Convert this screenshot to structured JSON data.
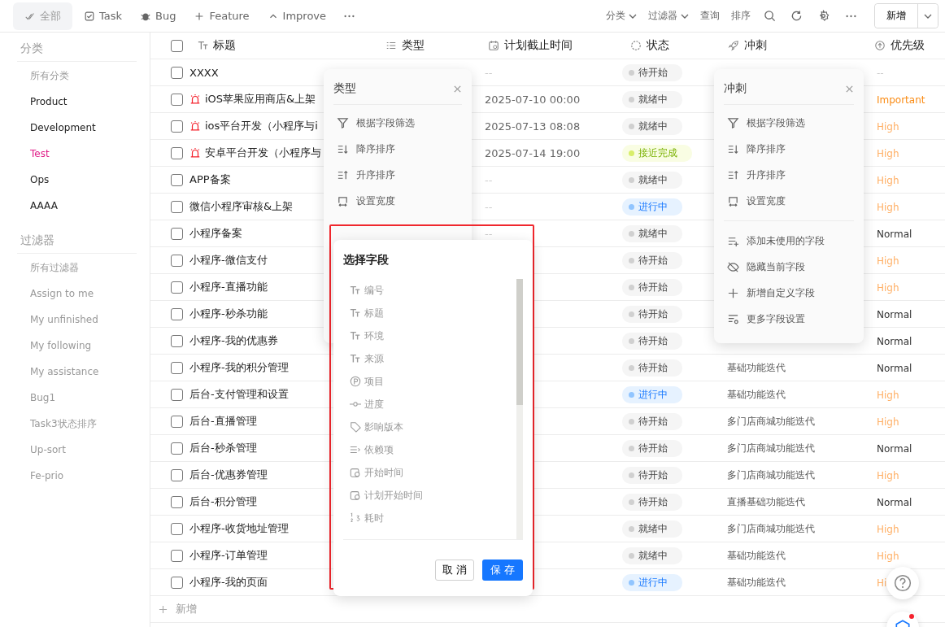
{
  "toolbar": {
    "tabs": [
      {
        "label": "全部",
        "selected": true
      },
      {
        "label": "Task",
        "selected": false
      },
      {
        "label": "Bug",
        "selected": false
      },
      {
        "label": "Feature",
        "selected": false
      },
      {
        "label": "Improve",
        "selected": false
      }
    ],
    "dropdowns": [
      "分类",
      "过滤器"
    ],
    "actions": [
      "查询",
      "排序"
    ],
    "new_button": "新增"
  },
  "sidebar": {
    "sections": [
      {
        "title": "分类",
        "items": [
          {
            "label": "所有分类",
            "muted": true,
            "selected": false
          },
          {
            "label": "Product",
            "muted": false,
            "selected": false
          },
          {
            "label": "Development",
            "muted": false,
            "selected": false
          },
          {
            "label": "Test",
            "muted": false,
            "selected": true
          },
          {
            "label": "Ops",
            "muted": false,
            "selected": false
          },
          {
            "label": "AAAA",
            "muted": false,
            "selected": false
          }
        ]
      },
      {
        "title": "过滤器",
        "items": [
          {
            "label": "所有过滤器",
            "muted": true,
            "selected": false
          },
          {
            "label": "Assign to me",
            "muted": true,
            "selected": false
          },
          {
            "label": "My unfinished",
            "muted": true,
            "selected": false
          },
          {
            "label": "My following",
            "muted": true,
            "selected": false
          },
          {
            "label": "My assistance",
            "muted": true,
            "selected": false
          },
          {
            "label": "Bug1",
            "muted": true,
            "selected": false
          },
          {
            "label": "Task3状态排序",
            "muted": true,
            "selected": false
          },
          {
            "label": "Up-sort",
            "muted": true,
            "selected": false
          },
          {
            "label": "Fe-prio",
            "muted": true,
            "selected": false
          }
        ]
      }
    ]
  },
  "table": {
    "select_all_checked": false,
    "columns": [
      "标题",
      "类型",
      "计划截止时间",
      "状态",
      "冲刺",
      "优先级"
    ],
    "rows": [
      {
        "title": "XXXX",
        "alarm": false,
        "checked": false,
        "due": "--",
        "status": {
          "label": "待开始",
          "kind": "plain"
        },
        "priority": {
          "label": "--",
          "kind": "none"
        }
      },
      {
        "title": "iOS苹果应用商店&上架",
        "alarm": true,
        "checked": false,
        "due": "2025-07-10 00:00",
        "status": {
          "label": "就绪中",
          "kind": "plain"
        },
        "priority": {
          "label": "Important",
          "kind": "important"
        }
      },
      {
        "title": "ios平台开发（小程序与i",
        "alarm": true,
        "checked": false,
        "due": "2025-07-13 08:08",
        "status": {
          "label": "就绪中",
          "kind": "plain"
        },
        "priority": {
          "label": "High",
          "kind": "high"
        }
      },
      {
        "title": "安卓平台开发（小程序与",
        "alarm": true,
        "checked": false,
        "due": "2025-07-14 19:00",
        "status": {
          "label": "接近完成",
          "kind": "near"
        },
        "priority": {
          "label": "High",
          "kind": "high"
        }
      },
      {
        "title": "APP备案",
        "alarm": false,
        "checked": false,
        "due": "--",
        "status": {
          "label": "就绪中",
          "kind": "plain"
        },
        "priority": {
          "label": "High",
          "kind": "high"
        }
      },
      {
        "title": "微信小程序审核&上架",
        "alarm": false,
        "checked": false,
        "due": "--",
        "status": {
          "label": "进行中",
          "kind": "progress"
        },
        "priority": {
          "label": "High",
          "kind": "high"
        }
      },
      {
        "title": "小程序备案",
        "alarm": false,
        "checked": false,
        "due": "--",
        "status": {
          "label": "就绪中",
          "kind": "plain"
        },
        "priority": {
          "label": "Normal",
          "kind": "normal"
        }
      },
      {
        "title": "小程序-微信支付",
        "alarm": false,
        "checked": false,
        "status": {
          "label": "待开始",
          "kind": "plain"
        },
        "priority": {
          "label": "High",
          "kind": "high"
        }
      },
      {
        "title": "小程序-直播功能",
        "alarm": false,
        "checked": false,
        "status": {
          "label": "待开始",
          "kind": "plain"
        },
        "priority": {
          "label": "High",
          "kind": "high"
        }
      },
      {
        "title": "小程序-秒杀功能",
        "alarm": false,
        "checked": false,
        "status": {
          "label": "待开始",
          "kind": "plain"
        },
        "priority": {
          "label": "Normal",
          "kind": "normal"
        }
      },
      {
        "title": "小程序-我的优惠券",
        "alarm": false,
        "checked": false,
        "status": {
          "label": "待开始",
          "kind": "plain"
        },
        "priority": {
          "label": "Normal",
          "kind": "normal"
        }
      },
      {
        "title": "小程序-我的积分管理",
        "alarm": false,
        "checked": false,
        "status": {
          "label": "待开始",
          "kind": "plain"
        },
        "sprint": "基础功能迭代",
        "priority": {
          "label": "Normal",
          "kind": "normal"
        }
      },
      {
        "title": "后台-支付管理和设置",
        "alarm": false,
        "checked": false,
        "status": {
          "label": "进行中",
          "kind": "progress"
        },
        "sprint": "基础功能迭代",
        "priority": {
          "label": "High",
          "kind": "high"
        }
      },
      {
        "title": "后台-直播管理",
        "alarm": false,
        "checked": false,
        "status": {
          "label": "待开始",
          "kind": "plain"
        },
        "sprint": "多门店商城功能迭代",
        "priority": {
          "label": "High",
          "kind": "high"
        }
      },
      {
        "title": "后台-秒杀管理",
        "alarm": false,
        "checked": false,
        "status": {
          "label": "待开始",
          "kind": "plain"
        },
        "sprint": "多门店商城功能迭代",
        "priority": {
          "label": "Normal",
          "kind": "normal"
        }
      },
      {
        "title": "后台-优惠券管理",
        "alarm": false,
        "checked": false,
        "status": {
          "label": "待开始",
          "kind": "plain"
        },
        "sprint": "多门店商城功能迭代",
        "priority": {
          "label": "High",
          "kind": "high"
        }
      },
      {
        "title": "后台-积分管理",
        "alarm": false,
        "checked": false,
        "status": {
          "label": "待开始",
          "kind": "plain"
        },
        "sprint": "直播基础功能迭代",
        "priority": {
          "label": "Normal",
          "kind": "normal"
        }
      },
      {
        "title": "小程序-收货地址管理",
        "alarm": false,
        "checked": false,
        "status": {
          "label": "就绪中",
          "kind": "plain"
        },
        "sprint": "多门店商城功能迭代",
        "priority": {
          "label": "High",
          "kind": "high"
        }
      },
      {
        "title": "小程序-订单管理",
        "alarm": false,
        "checked": false,
        "status": {
          "label": "就绪中",
          "kind": "plain"
        },
        "sprint": "基础功能迭代",
        "priority": {
          "label": "High",
          "kind": "high"
        }
      },
      {
        "title": "小程序-我的页面",
        "alarm": false,
        "checked": false,
        "status": {
          "label": "进行中",
          "kind": "progress"
        },
        "sprint": "基础功能迭代",
        "priority": {
          "label": "Hi",
          "kind": "high"
        }
      }
    ],
    "add_row": "新增"
  },
  "type_menu": {
    "title": "类型",
    "items": [
      {
        "label": "根据字段筛选",
        "kind": "filter"
      },
      {
        "label": "降序排序",
        "kind": "sort-desc"
      },
      {
        "label": "升序排序",
        "kind": "sort-asc"
      },
      {
        "label": "设置宽度",
        "kind": "width"
      }
    ]
  },
  "sprint_menu": {
    "title": "冲刺",
    "groups": [
      [
        {
          "label": "根据字段筛选",
          "kind": "filter"
        },
        {
          "label": "降序排序",
          "kind": "sort-desc"
        },
        {
          "label": "升序排序",
          "kind": "sort-asc"
        },
        {
          "label": "设置宽度",
          "kind": "width"
        }
      ],
      [
        {
          "label": "添加未使用的字段",
          "kind": "add-field"
        },
        {
          "label": "隐藏当前字段",
          "kind": "hide"
        },
        {
          "label": "新增自定义字段",
          "kind": "new"
        },
        {
          "label": "更多字段设置",
          "kind": "settings"
        }
      ]
    ]
  },
  "field_picker": {
    "title": "选择字段",
    "fields": [
      {
        "label": "编号",
        "kind": "text"
      },
      {
        "label": "标题",
        "kind": "text"
      },
      {
        "label": "环境",
        "kind": "text"
      },
      {
        "label": "来源",
        "kind": "text"
      },
      {
        "label": "项目",
        "kind": "project"
      },
      {
        "label": "进度",
        "kind": "progress"
      },
      {
        "label": "影响版本",
        "kind": "version"
      },
      {
        "label": "依赖项",
        "kind": "relation"
      },
      {
        "label": "开始时间",
        "kind": "date"
      },
      {
        "label": "计划开始时间",
        "kind": "date"
      },
      {
        "label": "耗时",
        "kind": "number"
      }
    ],
    "cancel": "取 消",
    "save": "保 存"
  }
}
